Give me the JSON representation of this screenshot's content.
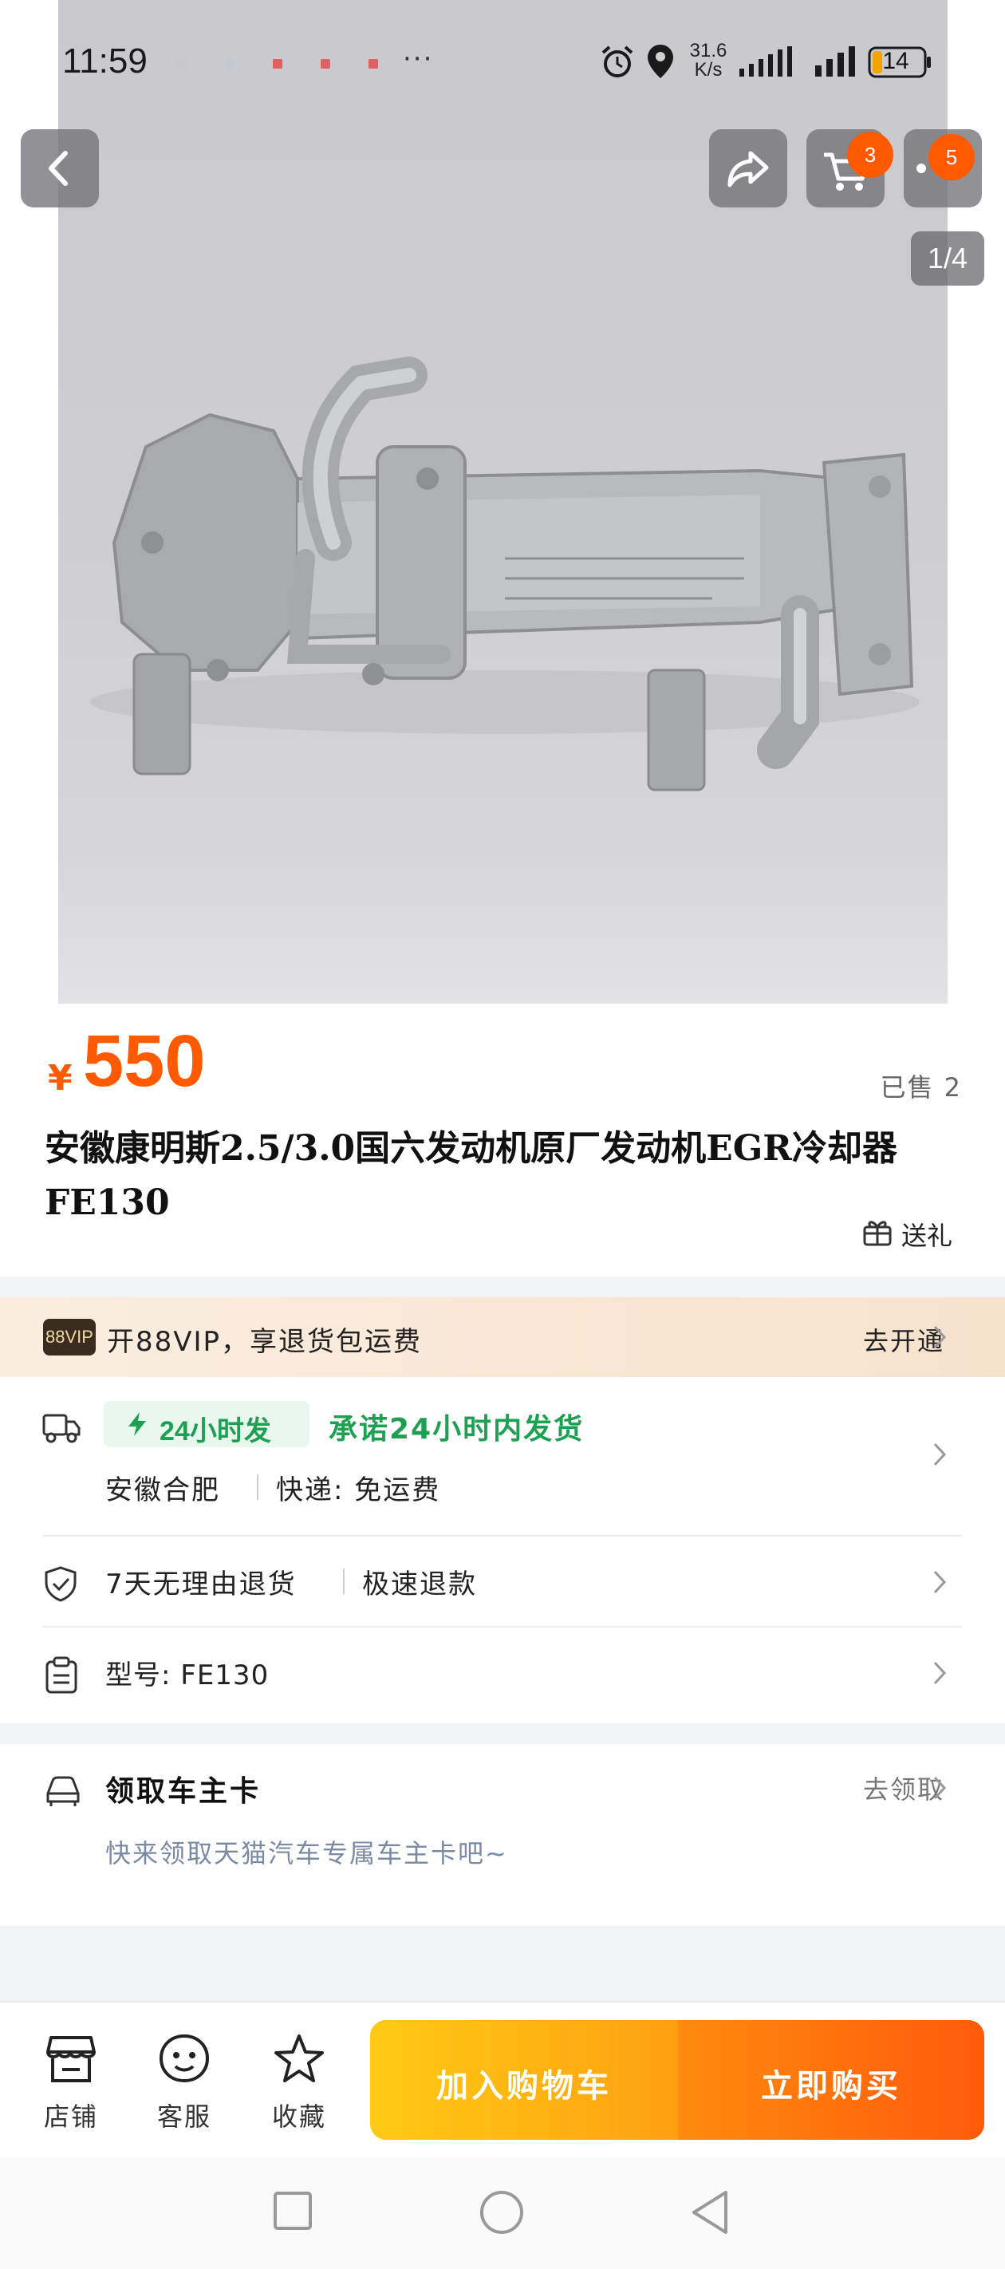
{
  "status_bar": {
    "time": "11:59",
    "more": "···",
    "net_speed_value": "31.6",
    "net_speed_unit": "K/s",
    "battery": "14"
  },
  "top_nav": {
    "cart_badge": "3",
    "more_badge": "5",
    "image_counter": "1/4"
  },
  "product": {
    "currency": "¥",
    "price": "550",
    "sold": "已售 2",
    "title": "安徽康明斯2.5/3.0国六发动机原厂发动机EGR冷却器FE130",
    "gift_label": "送礼"
  },
  "vip": {
    "badge": "88VIP",
    "text": "开88VIP，享退货包运费",
    "action": "去开通"
  },
  "shipping": {
    "tag": "24小时发",
    "promise": "承诺24小时内发货",
    "origin": "安徽合肥",
    "fee": "快递: 免运费"
  },
  "returns": {
    "policy": "7天无理由退货",
    "refund": "极速退款"
  },
  "model": {
    "text": "型号: FE130"
  },
  "car_card": {
    "title": "领取车主卡",
    "action": "去领取",
    "subtitle": "快来领取天猫汽车专属车主卡吧~"
  },
  "bottom_bar": {
    "shop": "店铺",
    "service": "客服",
    "favorite": "收藏",
    "add_to_cart": "加入购物车",
    "buy_now": "立即购买"
  },
  "colors": {
    "accent": "#ff5a00",
    "green": "#1ea052",
    "cart_gradient_start": "#ffca14",
    "buy_gradient_end": "#ff5a0a"
  },
  "icons": [
    "back-icon",
    "share-icon",
    "cart-icon",
    "more-icon",
    "gift-icon",
    "truck-icon",
    "bolt-icon",
    "shield-check-icon",
    "clipboard-icon",
    "car-icon",
    "shop-icon",
    "smile-icon",
    "star-icon",
    "chevron-right-icon",
    "square-nav-icon",
    "circle-nav-icon",
    "triangle-nav-icon"
  ]
}
